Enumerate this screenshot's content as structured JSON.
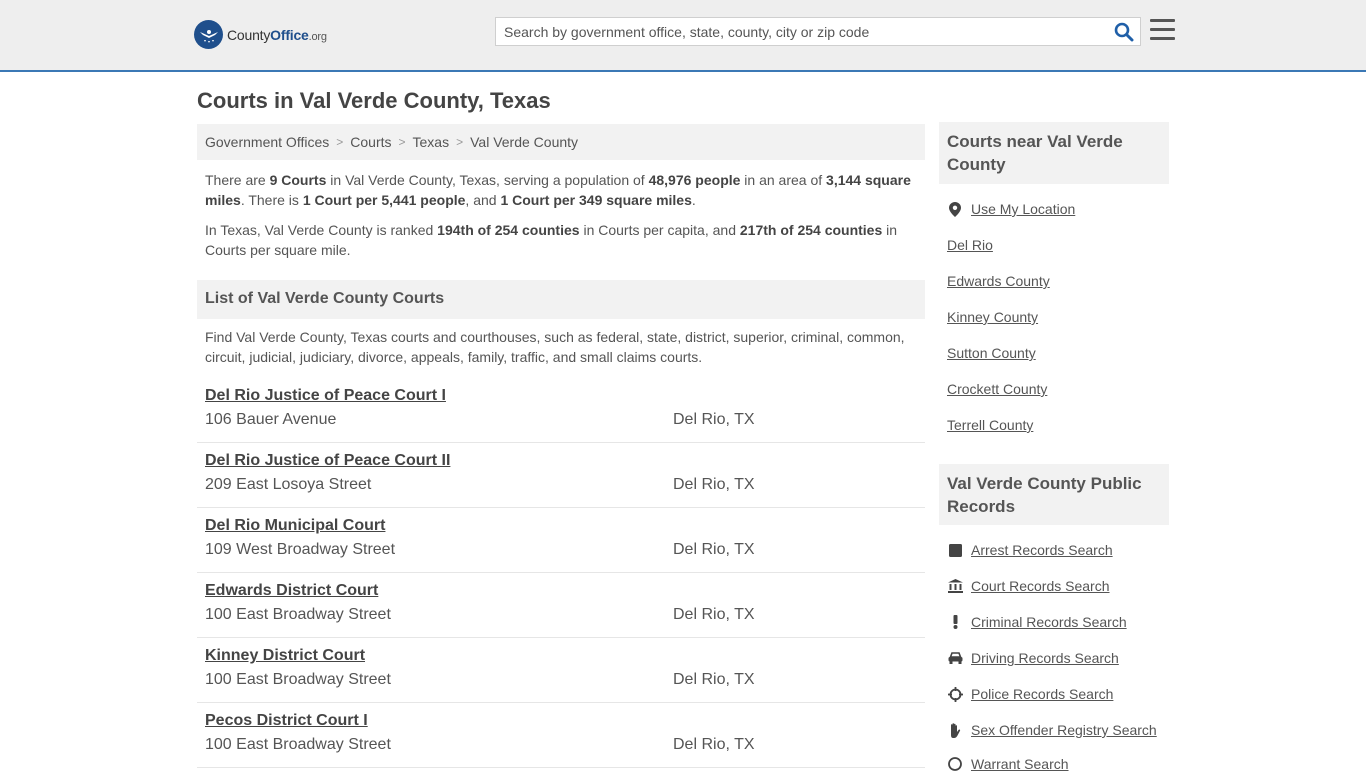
{
  "header": {
    "logo_main": "County",
    "logo_bold": "Office",
    "logo_tld": ".org",
    "search_placeholder": "Search by government office, state, county, city or zip code"
  },
  "page_title": "Courts in Val Verde County, Texas",
  "breadcrumb": [
    "Government Offices",
    "Courts",
    "Texas",
    "Val Verde County"
  ],
  "summary": {
    "p1_a": "There are ",
    "p1_count": "9 Courts",
    "p1_b": " in Val Verde County, Texas, serving a population of ",
    "p1_pop": "48,976 people",
    "p1_c": " in an area of ",
    "p1_area": "3,144 square miles",
    "p1_d": ". There is ",
    "p1_per_people": "1 Court per 5,441 people",
    "p1_e": ", and ",
    "p1_per_area": "1 Court per 349 square miles",
    "p1_f": ".",
    "p2_a": "In Texas, Val Verde County is ranked ",
    "p2_rank1": "194th of 254 counties",
    "p2_b": " in Courts per capita, and ",
    "p2_rank2": "217th of 254 counties",
    "p2_c": " in Courts per square mile."
  },
  "list_heading": "List of Val Verde County Courts",
  "list_intro": "Find Val Verde County, Texas courts and courthouses, such as federal, state, district, superior, criminal, common, circuit, judicial, judiciary, divorce, appeals, family, traffic, and small claims courts.",
  "courts": [
    {
      "name": "Del Rio Justice of Peace Court I",
      "address": "106 Bauer Avenue",
      "city": "Del Rio, TX"
    },
    {
      "name": "Del Rio Justice of Peace Court II",
      "address": "209 East Losoya Street",
      "city": "Del Rio, TX"
    },
    {
      "name": "Del Rio Municipal Court",
      "address": "109 West Broadway Street",
      "city": "Del Rio, TX"
    },
    {
      "name": "Edwards District Court",
      "address": "100 East Broadway Street",
      "city": "Del Rio, TX"
    },
    {
      "name": "Kinney District Court",
      "address": "100 East Broadway Street",
      "city": "Del Rio, TX"
    },
    {
      "name": "Pecos District Court I",
      "address": "100 East Broadway Street",
      "city": "Del Rio, TX"
    }
  ],
  "sidebar": {
    "nearby_heading": "Courts near Val Verde County",
    "nearby": [
      {
        "label": "Use My Location",
        "icon": "map-pin-icon"
      },
      {
        "label": "Del Rio"
      },
      {
        "label": "Edwards County"
      },
      {
        "label": "Kinney County"
      },
      {
        "label": "Sutton County"
      },
      {
        "label": "Crockett County"
      },
      {
        "label": "Terrell County"
      }
    ],
    "records_heading": "Val Verde County Public Records",
    "records": [
      {
        "label": "Arrest Records Search",
        "icon": "square-icon"
      },
      {
        "label": "Court Records Search",
        "icon": "courthouse-icon"
      },
      {
        "label": "Criminal Records Search",
        "icon": "exclamation-icon"
      },
      {
        "label": "Driving Records Search",
        "icon": "car-icon"
      },
      {
        "label": "Police Records Search",
        "icon": "crosshair-icon"
      },
      {
        "label": "Sex Offender Registry Search",
        "icon": "hand-icon"
      },
      {
        "label": "Warrant Search",
        "icon": "warrant-icon"
      }
    ]
  }
}
